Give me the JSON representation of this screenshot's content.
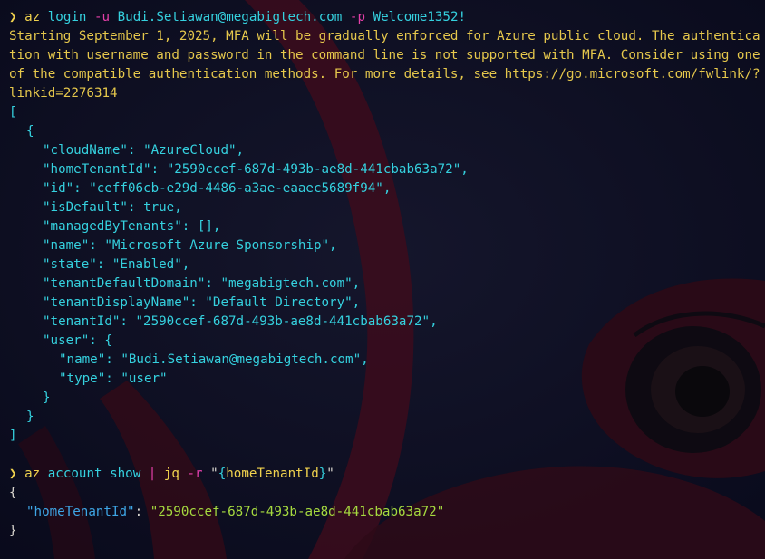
{
  "prompt_symbol": "❯",
  "commands": {
    "login": {
      "cmd": "az",
      "sub": "login",
      "user_flag": "-u",
      "user": "Budi.Setiawan@megabigtech.com",
      "pass_flag": "-p",
      "password": "Welcome1352!"
    },
    "show": {
      "cmd": "az",
      "args": "account show",
      "pipe": "|",
      "jq": "jq",
      "flag": "-r",
      "quote": "\"",
      "brace_open": "{",
      "field": "homeTenantId",
      "brace_close": "}"
    }
  },
  "warning": "Starting September 1, 2025, MFA will be gradually enforced for Azure public cloud. The authentication with username and password in the command line is not supported with MFA. Consider using one of the compatible authentication methods. For more details, see https://go.microsoft.com/fwlink/?linkid=2276314",
  "json_output": {
    "open_bracket": "[",
    "open_brace": "{",
    "fields": [
      {
        "key": "\"cloudName\"",
        "value": "\"AzureCloud\","
      },
      {
        "key": "\"homeTenantId\"",
        "value": "\"2590ccef-687d-493b-ae8d-441cbab63a72\","
      },
      {
        "key": "\"id\"",
        "value": "\"ceff06cb-e29d-4486-a3ae-eaaec5689f94\","
      },
      {
        "key": "\"isDefault\"",
        "value": "true,"
      },
      {
        "key": "\"managedByTenants\"",
        "value": "[],"
      },
      {
        "key": "\"name\"",
        "value": "\"Microsoft Azure Sponsorship\","
      },
      {
        "key": "\"state\"",
        "value": "\"Enabled\","
      },
      {
        "key": "\"tenantDefaultDomain\"",
        "value": "\"megabigtech.com\","
      },
      {
        "key": "\"tenantDisplayName\"",
        "value": "\"Default Directory\","
      },
      {
        "key": "\"tenantId\"",
        "value": "\"2590ccef-687d-493b-ae8d-441cbab63a72\","
      }
    ],
    "user_key": "\"user\"",
    "user_fields": [
      {
        "key": "\"name\"",
        "value": "\"Budi.Setiawan@megabigtech.com\","
      },
      {
        "key": "\"type\"",
        "value": "\"user\""
      }
    ],
    "inner_close": "}",
    "close_brace": "}",
    "close_bracket": "]"
  },
  "jq_output": {
    "open": "{",
    "key": "\"homeTenantId\"",
    "colon": ":",
    "value": "\"2590ccef-687d-493b-ae8d-441cbab63a72\"",
    "close": "}"
  },
  "colors": {
    "background": "#0c0d1d",
    "warning": "#e6c84c",
    "json": "#35d1df",
    "flag": "#e43fa8",
    "string": "#a6da3f",
    "key": "#3ea6e6"
  }
}
